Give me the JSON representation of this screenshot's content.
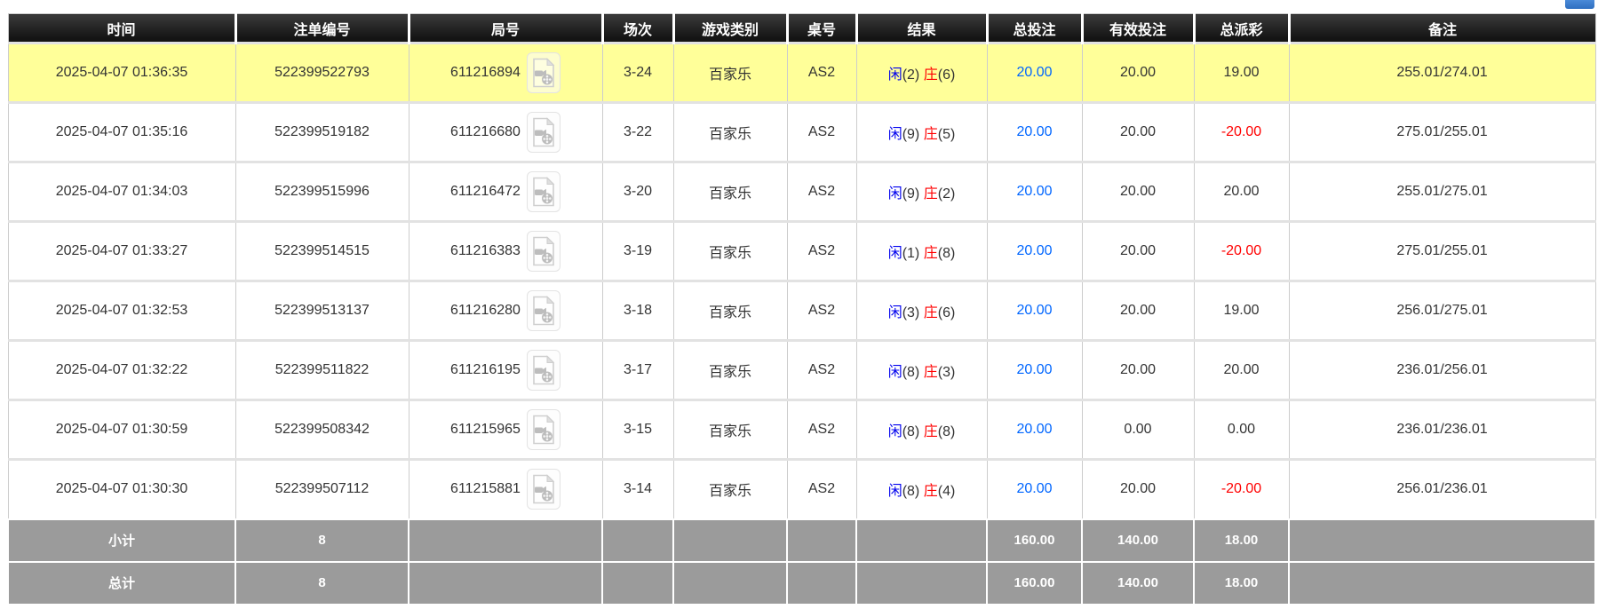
{
  "colors": {
    "header_bg": "#1a1a1a",
    "highlight_row": "#ffff99",
    "summary_bg": "#9b9b9b",
    "bet_amount_blue": "#0066ff",
    "player_blue": "#0000ee",
    "banker_red": "#ff0000",
    "negative_red": "#ff0000",
    "partial_button_blue": "#3b7fd0"
  },
  "icons": {
    "video_replay": "video-file-icon"
  },
  "strings": {
    "player_label": "闲",
    "banker_label": "庄"
  },
  "table": {
    "columns": [
      {
        "key": "time",
        "label": "时间"
      },
      {
        "key": "bet_id",
        "label": "注单编号"
      },
      {
        "key": "game_id",
        "label": "局号"
      },
      {
        "key": "session",
        "label": "场次"
      },
      {
        "key": "game_type",
        "label": "游戏类别"
      },
      {
        "key": "table_no",
        "label": "桌号"
      },
      {
        "key": "result",
        "label": "结果"
      },
      {
        "key": "total_bet",
        "label": "总投注"
      },
      {
        "key": "valid_bet",
        "label": "有效投注"
      },
      {
        "key": "payout",
        "label": "总派彩"
      },
      {
        "key": "remark",
        "label": "备注"
      }
    ],
    "rows": [
      {
        "time": "2025-04-07 01:36:35",
        "bet_id": "522399522793",
        "game_id": "611216894",
        "session": "3-24",
        "game_type": "百家乐",
        "table_no": "AS2",
        "result_player": "(2)",
        "result_banker": "(6)",
        "total_bet": "20.00",
        "valid_bet": "20.00",
        "payout": "19.00",
        "remark": "255.01/274.01",
        "highlight": true
      },
      {
        "time": "2025-04-07 01:35:16",
        "bet_id": "522399519182",
        "game_id": "611216680",
        "session": "3-22",
        "game_type": "百家乐",
        "table_no": "AS2",
        "result_player": "(9)",
        "result_banker": "(5)",
        "total_bet": "20.00",
        "valid_bet": "20.00",
        "payout": "-20.00",
        "remark": "275.01/255.01",
        "highlight": false
      },
      {
        "time": "2025-04-07 01:34:03",
        "bet_id": "522399515996",
        "game_id": "611216472",
        "session": "3-20",
        "game_type": "百家乐",
        "table_no": "AS2",
        "result_player": "(9)",
        "result_banker": "(2)",
        "total_bet": "20.00",
        "valid_bet": "20.00",
        "payout": "20.00",
        "remark": "255.01/275.01",
        "highlight": false
      },
      {
        "time": "2025-04-07 01:33:27",
        "bet_id": "522399514515",
        "game_id": "611216383",
        "session": "3-19",
        "game_type": "百家乐",
        "table_no": "AS2",
        "result_player": "(1)",
        "result_banker": "(8)",
        "total_bet": "20.00",
        "valid_bet": "20.00",
        "payout": "-20.00",
        "remark": "275.01/255.01",
        "highlight": false
      },
      {
        "time": "2025-04-07 01:32:53",
        "bet_id": "522399513137",
        "game_id": "611216280",
        "session": "3-18",
        "game_type": "百家乐",
        "table_no": "AS2",
        "result_player": "(3)",
        "result_banker": "(6)",
        "total_bet": "20.00",
        "valid_bet": "20.00",
        "payout": "19.00",
        "remark": "256.01/275.01",
        "highlight": false
      },
      {
        "time": "2025-04-07 01:32:22",
        "bet_id": "522399511822",
        "game_id": "611216195",
        "session": "3-17",
        "game_type": "百家乐",
        "table_no": "AS2",
        "result_player": "(8)",
        "result_banker": "(3)",
        "total_bet": "20.00",
        "valid_bet": "20.00",
        "payout": "20.00",
        "remark": "236.01/256.01",
        "highlight": false
      },
      {
        "time": "2025-04-07 01:30:59",
        "bet_id": "522399508342",
        "game_id": "611215965",
        "session": "3-15",
        "game_type": "百家乐",
        "table_no": "AS2",
        "result_player": "(8)",
        "result_banker": "(8)",
        "total_bet": "20.00",
        "valid_bet": "0.00",
        "payout": "0.00",
        "remark": "236.01/236.01",
        "highlight": false
      },
      {
        "time": "2025-04-07 01:30:30",
        "bet_id": "522399507112",
        "game_id": "611215881",
        "session": "3-14",
        "game_type": "百家乐",
        "table_no": "AS2",
        "result_player": "(8)",
        "result_banker": "(4)",
        "total_bet": "20.00",
        "valid_bet": "20.00",
        "payout": "-20.00",
        "remark": "256.01/236.01",
        "highlight": false
      }
    ],
    "summary_rows": [
      {
        "label": "小计",
        "count": "8",
        "total_bet": "160.00",
        "valid_bet": "140.00",
        "payout": "18.00"
      },
      {
        "label": "总计",
        "count": "8",
        "total_bet": "160.00",
        "valid_bet": "140.00",
        "payout": "18.00"
      }
    ]
  }
}
